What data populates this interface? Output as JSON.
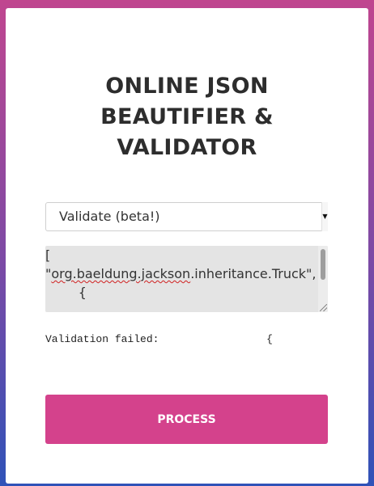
{
  "title": {
    "line1": "ONLINE JSON",
    "line2": "BEAUTIFIER &",
    "line3": "VALIDATOR"
  },
  "mode_select": {
    "selected": "Validate (beta!)"
  },
  "editor": {
    "line1": "[",
    "line2_quote": "\"",
    "line2_misspelled": "org.baeldung.jackson",
    "line2_rest": ".inheritance.Truck\",",
    "line3": "        {"
  },
  "result": {
    "label": "Validation failed:",
    "detail": "{"
  },
  "process_button": {
    "label": "PROCESS"
  },
  "colors": {
    "accent": "#d4428c",
    "gradient_top": "#c0468f",
    "gradient_bottom": "#2f52b8"
  }
}
